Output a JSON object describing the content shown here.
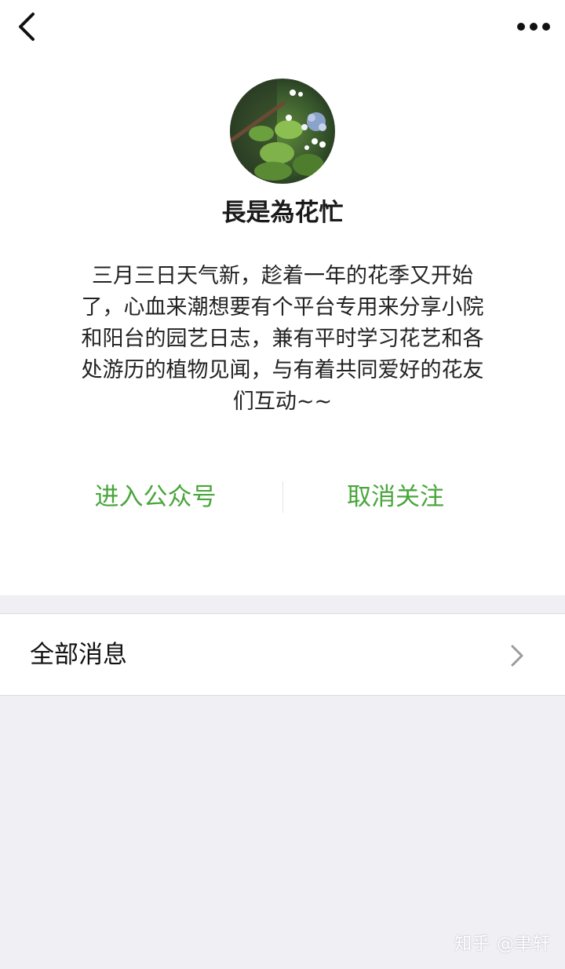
{
  "profile": {
    "name": "長是為花忙",
    "description": "三月三日天气新，趁着一年的花季又开始了，心血来潮想要有个平台专用来分享小院和阳台的园艺日志，兼有平时学习花艺和各处游历的植物见闻，与有着共同爱好的花友们互动~~"
  },
  "actions": {
    "enter_label": "进入公众号",
    "unfollow_label": "取消关注"
  },
  "list": {
    "all_messages_label": "全部消息"
  },
  "watermark": "知乎 @聿轩",
  "icons": {
    "back": "back-arrow-icon",
    "more": "more-dots-icon",
    "chevron": "chevron-right-icon"
  },
  "colors": {
    "accent": "#4aa63c",
    "background": "#efeff4"
  }
}
